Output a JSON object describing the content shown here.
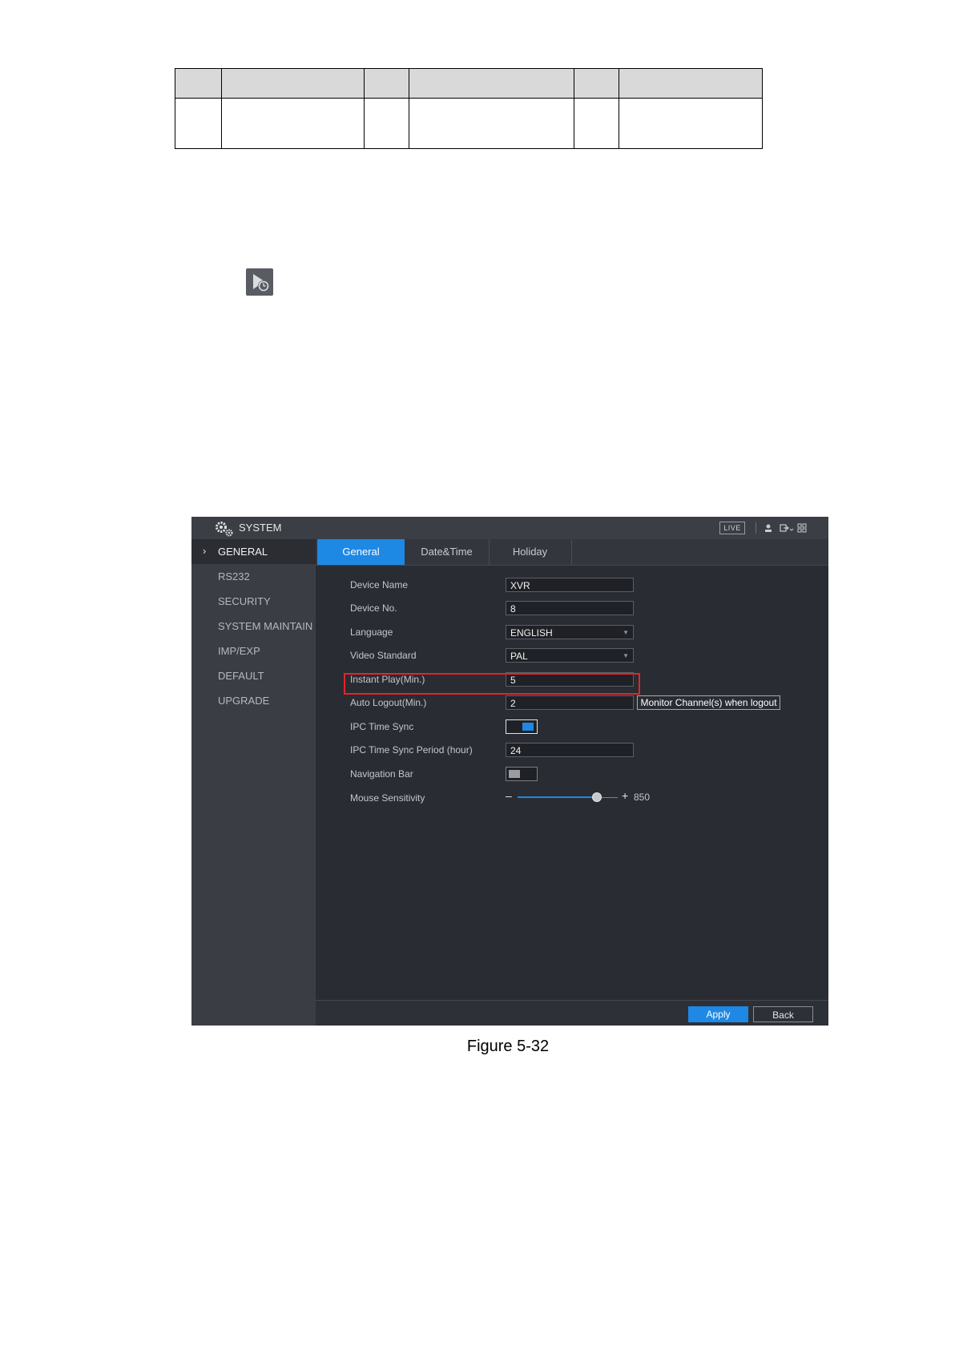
{
  "app": {
    "title": "SYSTEM",
    "live_label": "LIVE"
  },
  "colors": {
    "accent": "#1e88e5",
    "highlight": "#e0262b",
    "sidebar_bg": "#3a3d44",
    "content_bg": "#2a2c33"
  },
  "icons": {
    "inline": "playback-clock-icon",
    "title": "gear-cluster-icon",
    "toolbar": [
      "user-icon",
      "logout-icon",
      "grid-icon"
    ]
  },
  "sidebar": {
    "items": [
      {
        "label": "GENERAL",
        "active": true
      },
      {
        "label": "RS232",
        "active": false
      },
      {
        "label": "SECURITY",
        "active": false
      },
      {
        "label": "SYSTEM MAINTAIN",
        "active": false
      },
      {
        "label": "IMP/EXP",
        "active": false
      },
      {
        "label": "DEFAULT",
        "active": false
      },
      {
        "label": "UPGRADE",
        "active": false
      }
    ]
  },
  "tabs": [
    {
      "label": "General",
      "active": true
    },
    {
      "label": "Date&Time",
      "active": false
    },
    {
      "label": "Holiday",
      "active": false
    }
  ],
  "form": {
    "device_name": {
      "label": "Device Name",
      "value": "XVR"
    },
    "device_no": {
      "label": "Device No.",
      "value": "8"
    },
    "language": {
      "label": "Language",
      "value": "ENGLISH"
    },
    "video_standard": {
      "label": "Video Standard",
      "value": "PAL"
    },
    "instant_play": {
      "label": "Instant Play(Min.)",
      "value": "5"
    },
    "auto_logout": {
      "label": "Auto Logout(Min.)",
      "value": "2",
      "button": "Monitor Channel(s) when logout"
    },
    "ipc_time_sync": {
      "label": "IPC Time Sync",
      "enabled": true
    },
    "ipc_time_sync_period": {
      "label": "IPC Time Sync Period (hour)",
      "value": "24"
    },
    "navigation_bar": {
      "label": "Navigation Bar",
      "enabled": false
    },
    "mouse_sensitivity": {
      "label": "Mouse Sensitivity",
      "minus": "–",
      "plus": "+",
      "value": "850",
      "level": 0.79
    }
  },
  "actions": {
    "apply": "Apply",
    "back": "Back"
  },
  "caption": "Figure 5-32"
}
